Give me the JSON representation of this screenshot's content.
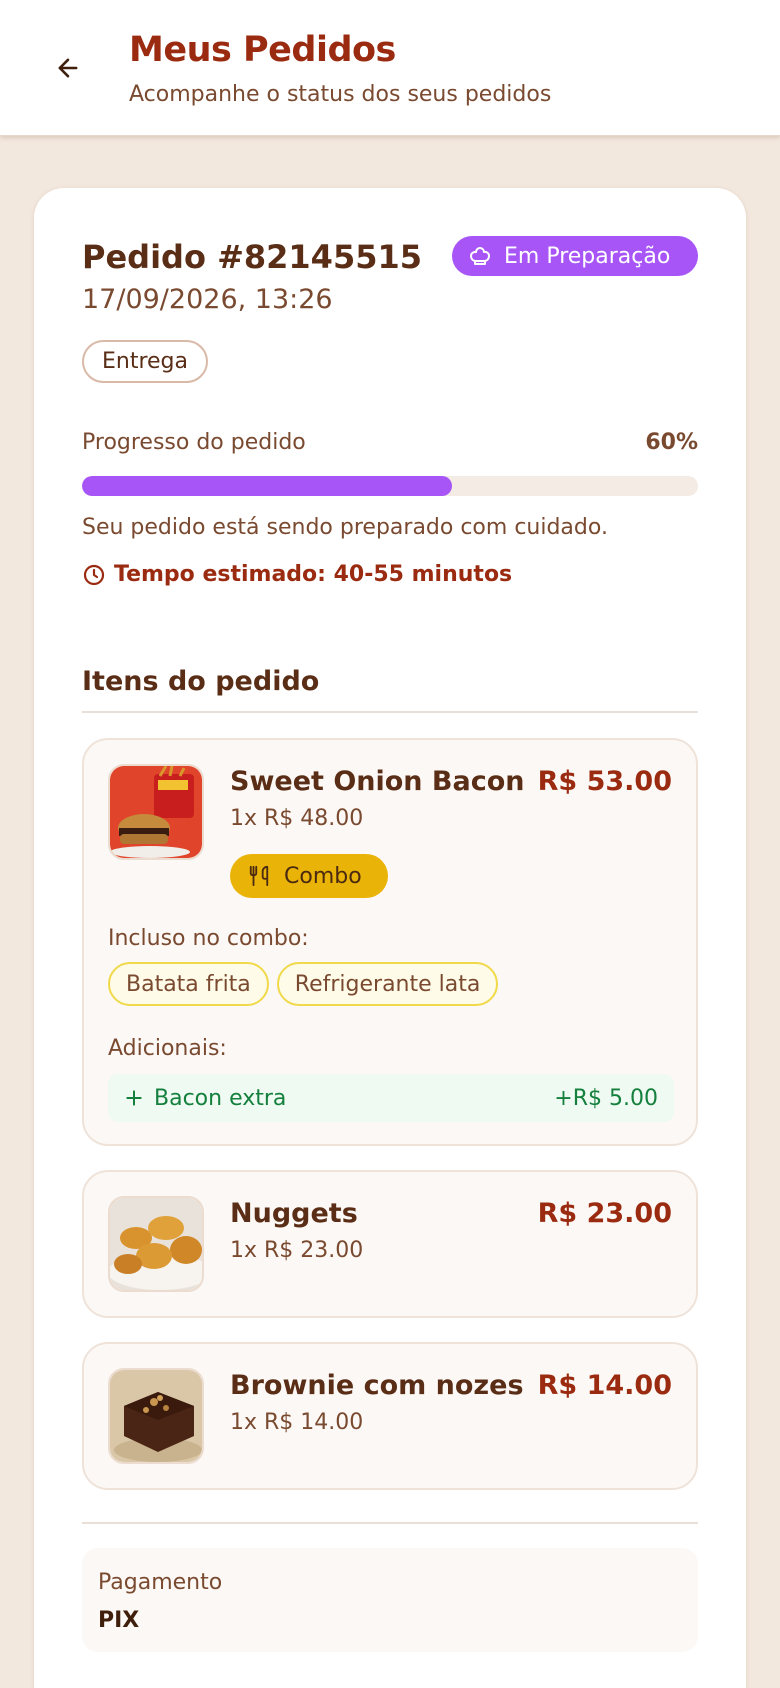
{
  "header": {
    "title": "Meus Pedidos",
    "subtitle": "Acompanhe o status dos seus pedidos"
  },
  "order": {
    "title": "Pedido #82145515",
    "date": "17/09/2026, 13:26",
    "status": "Em Preparação",
    "type": "Entrega",
    "progress_label": "Progresso do pedido",
    "progress_pct": "60%",
    "progress_value": 0.6,
    "progress_message": "Seu pedido está sendo preparado com cuidado.",
    "eta": "Tempo estimado: 40-55 minutos"
  },
  "items_title": "Itens do pedido",
  "items": [
    {
      "name": "Sweet Onion Bacon",
      "qty": "1x R$ 48.00",
      "price": "R$ 53.00",
      "badge": "Combo",
      "combo_label": "Incluso no combo:",
      "combo_items": [
        "Batata frita",
        "Refrigerante lata"
      ],
      "addons_label": "Adicionais:",
      "addons": [
        {
          "name": "Bacon extra",
          "price": "+R$ 5.00"
        }
      ]
    },
    {
      "name": "Nuggets",
      "qty": "1x R$ 23.00",
      "price": "R$ 23.00"
    },
    {
      "name": "Brownie com nozes",
      "qty": "1x R$ 14.00",
      "price": "R$ 14.00"
    }
  ],
  "payment": {
    "label": "Pagamento",
    "value": "PIX"
  },
  "colors": {
    "accent": "#9b2b10",
    "status": "#a855f7",
    "combo": "#eab308",
    "addon": "#15803d",
    "background": "#f3e8de"
  },
  "icons": {
    "back": "arrow-left-icon",
    "status": "chef-hat-icon",
    "eta": "clock-icon",
    "combo": "utensils-icon",
    "addon": "plus-icon"
  }
}
